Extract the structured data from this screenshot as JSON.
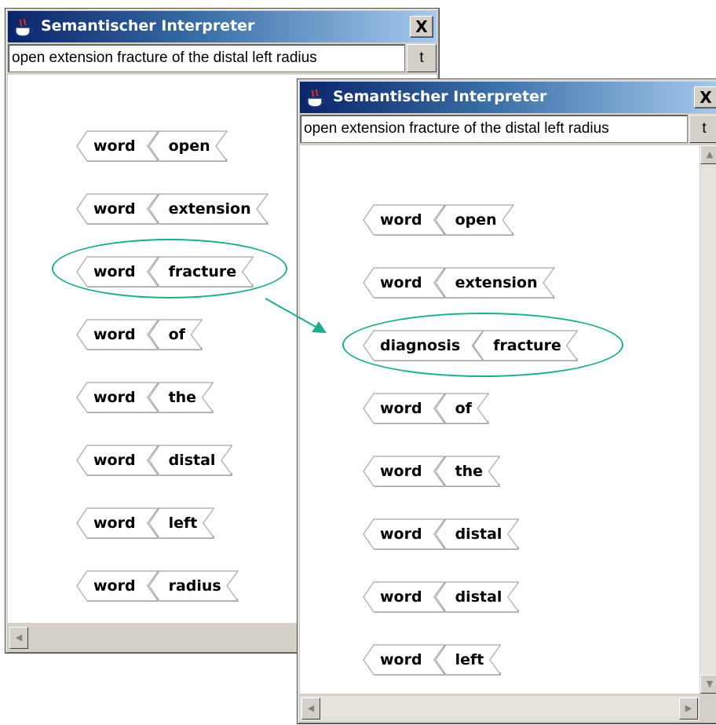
{
  "window_before": {
    "title": "Semantischer Interpreter",
    "close_label": "X",
    "input_value": "open extension fracture of the distal left radius",
    "button_label": "t",
    "scroll_left_glyph": "◀",
    "tokens": [
      {
        "type": "word",
        "value": "open"
      },
      {
        "type": "word",
        "value": "extension"
      },
      {
        "type": "word",
        "value": "fracture"
      },
      {
        "type": "word",
        "value": "of"
      },
      {
        "type": "word",
        "value": "the"
      },
      {
        "type": "word",
        "value": "distal"
      },
      {
        "type": "word",
        "value": "left"
      },
      {
        "type": "word",
        "value": "radius"
      }
    ]
  },
  "window_after": {
    "title": "Semantischer Interpreter",
    "close_label": "X",
    "input_value": "open extension fracture of the distal left radius",
    "button_label": "t",
    "scroll_up_glyph": "▲",
    "scroll_down_glyph": "▼",
    "scroll_left_glyph": "◀",
    "scroll_right_glyph": "▶",
    "tokens": [
      {
        "type": "word",
        "value": "open"
      },
      {
        "type": "word",
        "value": "extension"
      },
      {
        "type": "diagnosis",
        "value": "fracture"
      },
      {
        "type": "word",
        "value": "of"
      },
      {
        "type": "word",
        "value": "the"
      },
      {
        "type": "word",
        "value": "distal"
      },
      {
        "type": "word",
        "value": "distal"
      },
      {
        "type": "word",
        "value": "left"
      }
    ]
  },
  "colors": {
    "highlight": "#1aae8e",
    "titlebar_start": "#0a246a",
    "titlebar_end": "#a6caf0"
  },
  "icons": {
    "title_icon": "java-coffee-cup-icon",
    "close_icon": "close-x-icon"
  }
}
